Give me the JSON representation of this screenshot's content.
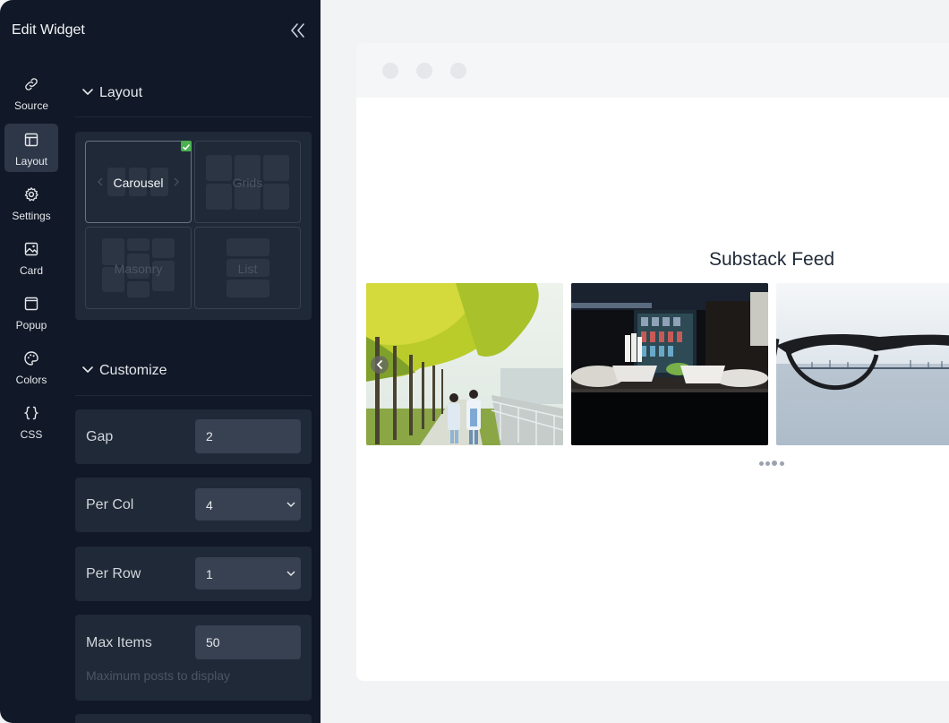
{
  "panel": {
    "title": "Edit Widget"
  },
  "nav": {
    "items": [
      {
        "label": "Source",
        "icon": "link-icon"
      },
      {
        "label": "Layout",
        "icon": "layout-icon",
        "active": true
      },
      {
        "label": "Settings",
        "icon": "gear-icon"
      },
      {
        "label": "Card",
        "icon": "image-icon"
      },
      {
        "label": "Popup",
        "icon": "window-icon"
      },
      {
        "label": "Colors",
        "icon": "palette-icon"
      },
      {
        "label": "CSS",
        "icon": "braces-icon"
      }
    ]
  },
  "layout_section": {
    "title": "Layout",
    "options": [
      {
        "label": "Carousel",
        "selected": true
      },
      {
        "label": "Grids",
        "selected": false
      },
      {
        "label": "Masonry",
        "selected": false
      },
      {
        "label": "List",
        "selected": false
      }
    ]
  },
  "customize_section": {
    "title": "Customize",
    "gap": {
      "label": "Gap",
      "value": "2"
    },
    "per_col": {
      "label": "Per Col",
      "value": "4"
    },
    "per_row": {
      "label": "Per Row",
      "value": "1"
    },
    "max_items": {
      "label": "Max Items",
      "value": "50",
      "hint": "Maximum posts to display"
    }
  },
  "preview": {
    "title": "Substack Feed",
    "slides": [
      "park-couple-photo",
      "street-food-night-photo",
      "eyeglasses-sea-photo"
    ],
    "pagination_count": 4,
    "pagination_active": 2
  },
  "colors": {
    "panel_bg": "#111827",
    "card_bg": "#1f2937",
    "input_bg": "#374151",
    "check_green": "#4caf50"
  }
}
